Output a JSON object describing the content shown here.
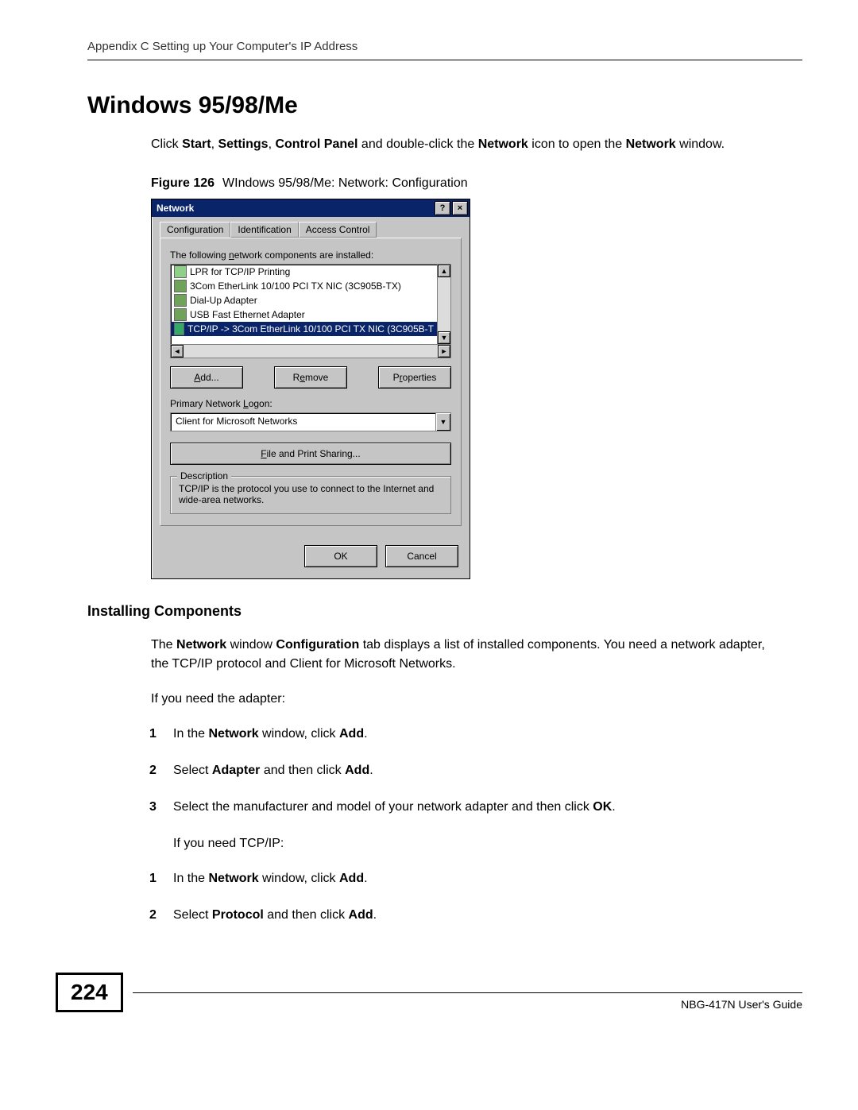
{
  "header": "Appendix C Setting up Your Computer's IP Address",
  "h1": "Windows 95/98/Me",
  "intro_parts": [
    "Click ",
    "Start",
    ", ",
    "Settings",
    ", ",
    "Control Panel",
    " and double-click the ",
    "Network",
    " icon to open the ",
    "Network",
    " window."
  ],
  "figure_label": "Figure 126",
  "figure_caption": "WIndows 95/98/Me: Network: Configuration",
  "dialog": {
    "title": "Network",
    "help_btn": "?",
    "close_btn": "×",
    "tabs": [
      "Configuration",
      "Identification",
      "Access Control"
    ],
    "list_label_pre": "The following ",
    "list_label_ul": "n",
    "list_label_post": "etwork components are installed:",
    "components": [
      "LPR for TCP/IP Printing",
      "3Com EtherLink 10/100 PCI TX NIC (3C905B-TX)",
      "Dial-Up Adapter",
      "USB Fast Ethernet Adapter",
      "TCP/IP -> 3Com EtherLink 10/100 PCI TX NIC (3C905B-T"
    ],
    "add_btn_ul": "A",
    "add_btn_rest": "dd...",
    "remove_btn_pre": "R",
    "remove_btn_ul": "e",
    "remove_btn_post": "move",
    "props_btn_pre": "P",
    "props_btn_ul": "r",
    "props_btn_post": "operties",
    "logon_label_pre": "Primary Network ",
    "logon_label_ul": "L",
    "logon_label_post": "ogon:",
    "logon_value": "Client for Microsoft Networks",
    "fps_btn_ul": "F",
    "fps_btn_rest": "ile and Print Sharing...",
    "desc_legend": "Description",
    "desc_text": "TCP/IP is the protocol you use to connect to the Internet and wide-area networks.",
    "ok": "OK",
    "cancel": "Cancel"
  },
  "h3": "Installing Components",
  "para2_parts": [
    "The ",
    "Network",
    " window ",
    "Configuration",
    " tab displays a list of installed components. You need a network adapter, the TCP/IP protocol and Client for Microsoft Networks."
  ],
  "para3": "If you need the adapter:",
  "stepsA": [
    [
      "In the ",
      "Network",
      " window, click ",
      "Add",
      "."
    ],
    [
      "Select ",
      "Adapter",
      " and then click ",
      "Add",
      "."
    ],
    [
      "Select the manufacturer and model of your network adapter and then click ",
      "OK",
      "."
    ]
  ],
  "para4": "If you need TCP/IP:",
  "stepsB": [
    [
      "In the ",
      "Network",
      " window, click ",
      "Add",
      "."
    ],
    [
      "Select ",
      "Protocol",
      " and then click ",
      "Add",
      "."
    ]
  ],
  "page_number": "224",
  "footer_guide": "NBG-417N User's Guide"
}
